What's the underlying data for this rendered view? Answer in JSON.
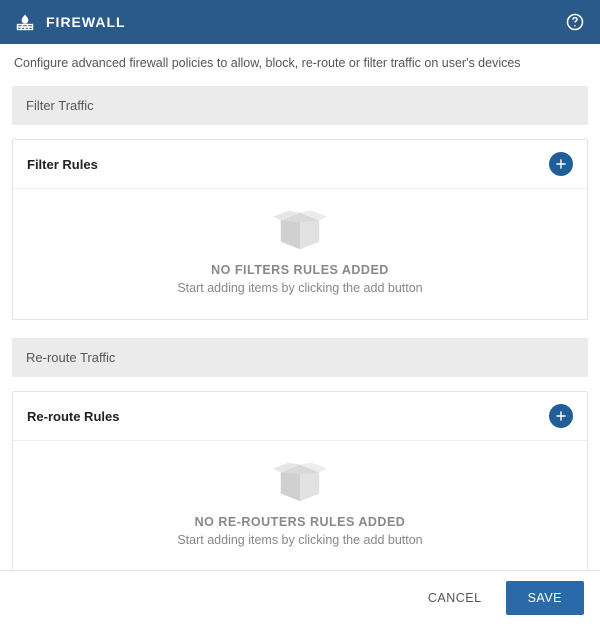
{
  "header": {
    "title": "FIREWALL"
  },
  "description": "Configure advanced firewall policies to allow, block, re-route or filter traffic on user's devices",
  "sections": {
    "filter": {
      "section_title": "Filter Traffic",
      "card_title": "Filter Rules",
      "empty_title": "NO FILTERS RULES ADDED",
      "empty_sub": "Start adding items by clicking the add button"
    },
    "reroute": {
      "section_title": "Re-route Traffic",
      "card_title": "Re-route Rules",
      "empty_title": "NO RE-ROUTERS RULES ADDED",
      "empty_sub": "Start adding items by clicking the add button"
    }
  },
  "footer": {
    "cancel_label": "CANCEL",
    "save_label": "SAVE"
  }
}
